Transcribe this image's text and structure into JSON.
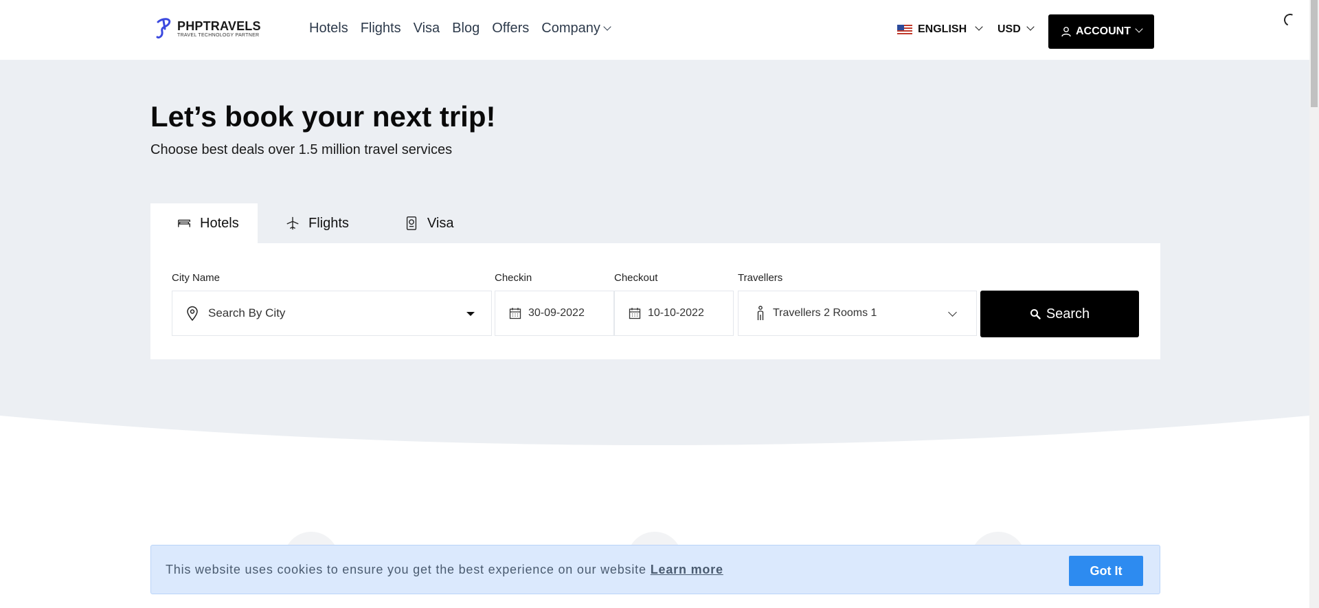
{
  "header": {
    "logo_title": "PHPTRAVELS",
    "logo_subtitle": "TRAVEL TECHNOLOGY PARTNER",
    "nav": [
      "Hotels",
      "Flights",
      "Visa",
      "Blog",
      "Offers",
      "Company"
    ],
    "language": "ENGLISH",
    "currency": "USD",
    "account_label": "ACCOUNT"
  },
  "hero": {
    "title": "Let’s book your next trip!",
    "subtitle": "Choose best deals over 1.5 million travel services"
  },
  "tabs": [
    {
      "label": "Hotels",
      "icon": "bed-icon"
    },
    {
      "label": "Flights",
      "icon": "plane-icon"
    },
    {
      "label": "Visa",
      "icon": "passport-icon"
    }
  ],
  "search": {
    "city_label": "City Name",
    "city_placeholder": "Search By City",
    "checkin_label": "Checkin",
    "checkin_value": "30-09-2022",
    "checkout_label": "Checkout",
    "checkout_value": "10-10-2022",
    "travellers_label": "Travellers",
    "travellers_value": "Travellers 2 Rooms 1",
    "search_button": "Search"
  },
  "cookie": {
    "message": "This website uses cookies to ensure you get the best experience on our website",
    "learn_more": "Learn more",
    "accept": "Got It"
  },
  "colors": {
    "hero_bg": "#eceff3",
    "primary_dark": "#000000",
    "cookie_bg": "#dbe9fd",
    "cookie_button": "#2d8bf0"
  }
}
